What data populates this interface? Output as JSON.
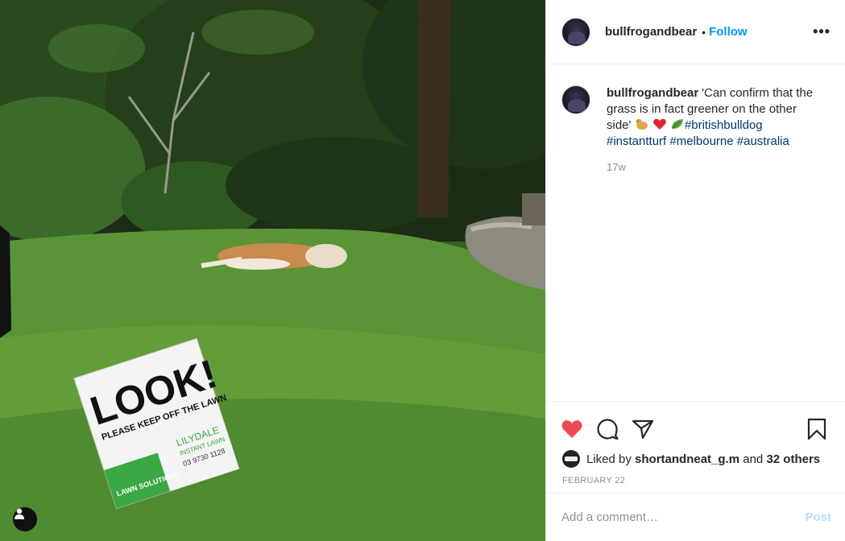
{
  "post": {
    "username": "bullfrogandbear",
    "follow_label": "Follow",
    "separator": "•",
    "more_label": "•••"
  },
  "photo": {
    "sign_line1": "LOOK!",
    "sign_line2": "PLEASE KEEP OFF THE LAWN",
    "sign_brand": "LILYDALE",
    "sign_sub": "INSTANT LAWN",
    "sign_phone": "03 9730 1128",
    "sign_logo": "LAWN SOLUTIONS",
    "user_tag_icon": "user-icon"
  },
  "caption": {
    "username": "bullfrogandbear",
    "text": "'Can confirm that the grass is in fact greener on the other side'",
    "emojis": [
      "dog-emoji",
      "heart-emoji",
      "leaf-emoji"
    ],
    "hashtags": [
      "#britishbulldog",
      "#instantturf",
      "#melbourne",
      "#australia"
    ],
    "time": "17w"
  },
  "actions": {
    "like_icon": "heart-icon",
    "comment_icon": "comment-icon",
    "share_icon": "share-icon",
    "save_icon": "bookmark-icon",
    "liked_by_prefix": "Liked by",
    "liked_by_user": "shortandneat_g.m",
    "and_label": "and",
    "others": "32 others",
    "date": "FEBRUARY 22"
  },
  "comment_box": {
    "placeholder": "Add a comment…",
    "post_label": "Post"
  },
  "colors": {
    "accent": "#0095f6",
    "like_red": "#ed4956",
    "hashtag": "#00376b",
    "muted": "#8e8e8e"
  }
}
